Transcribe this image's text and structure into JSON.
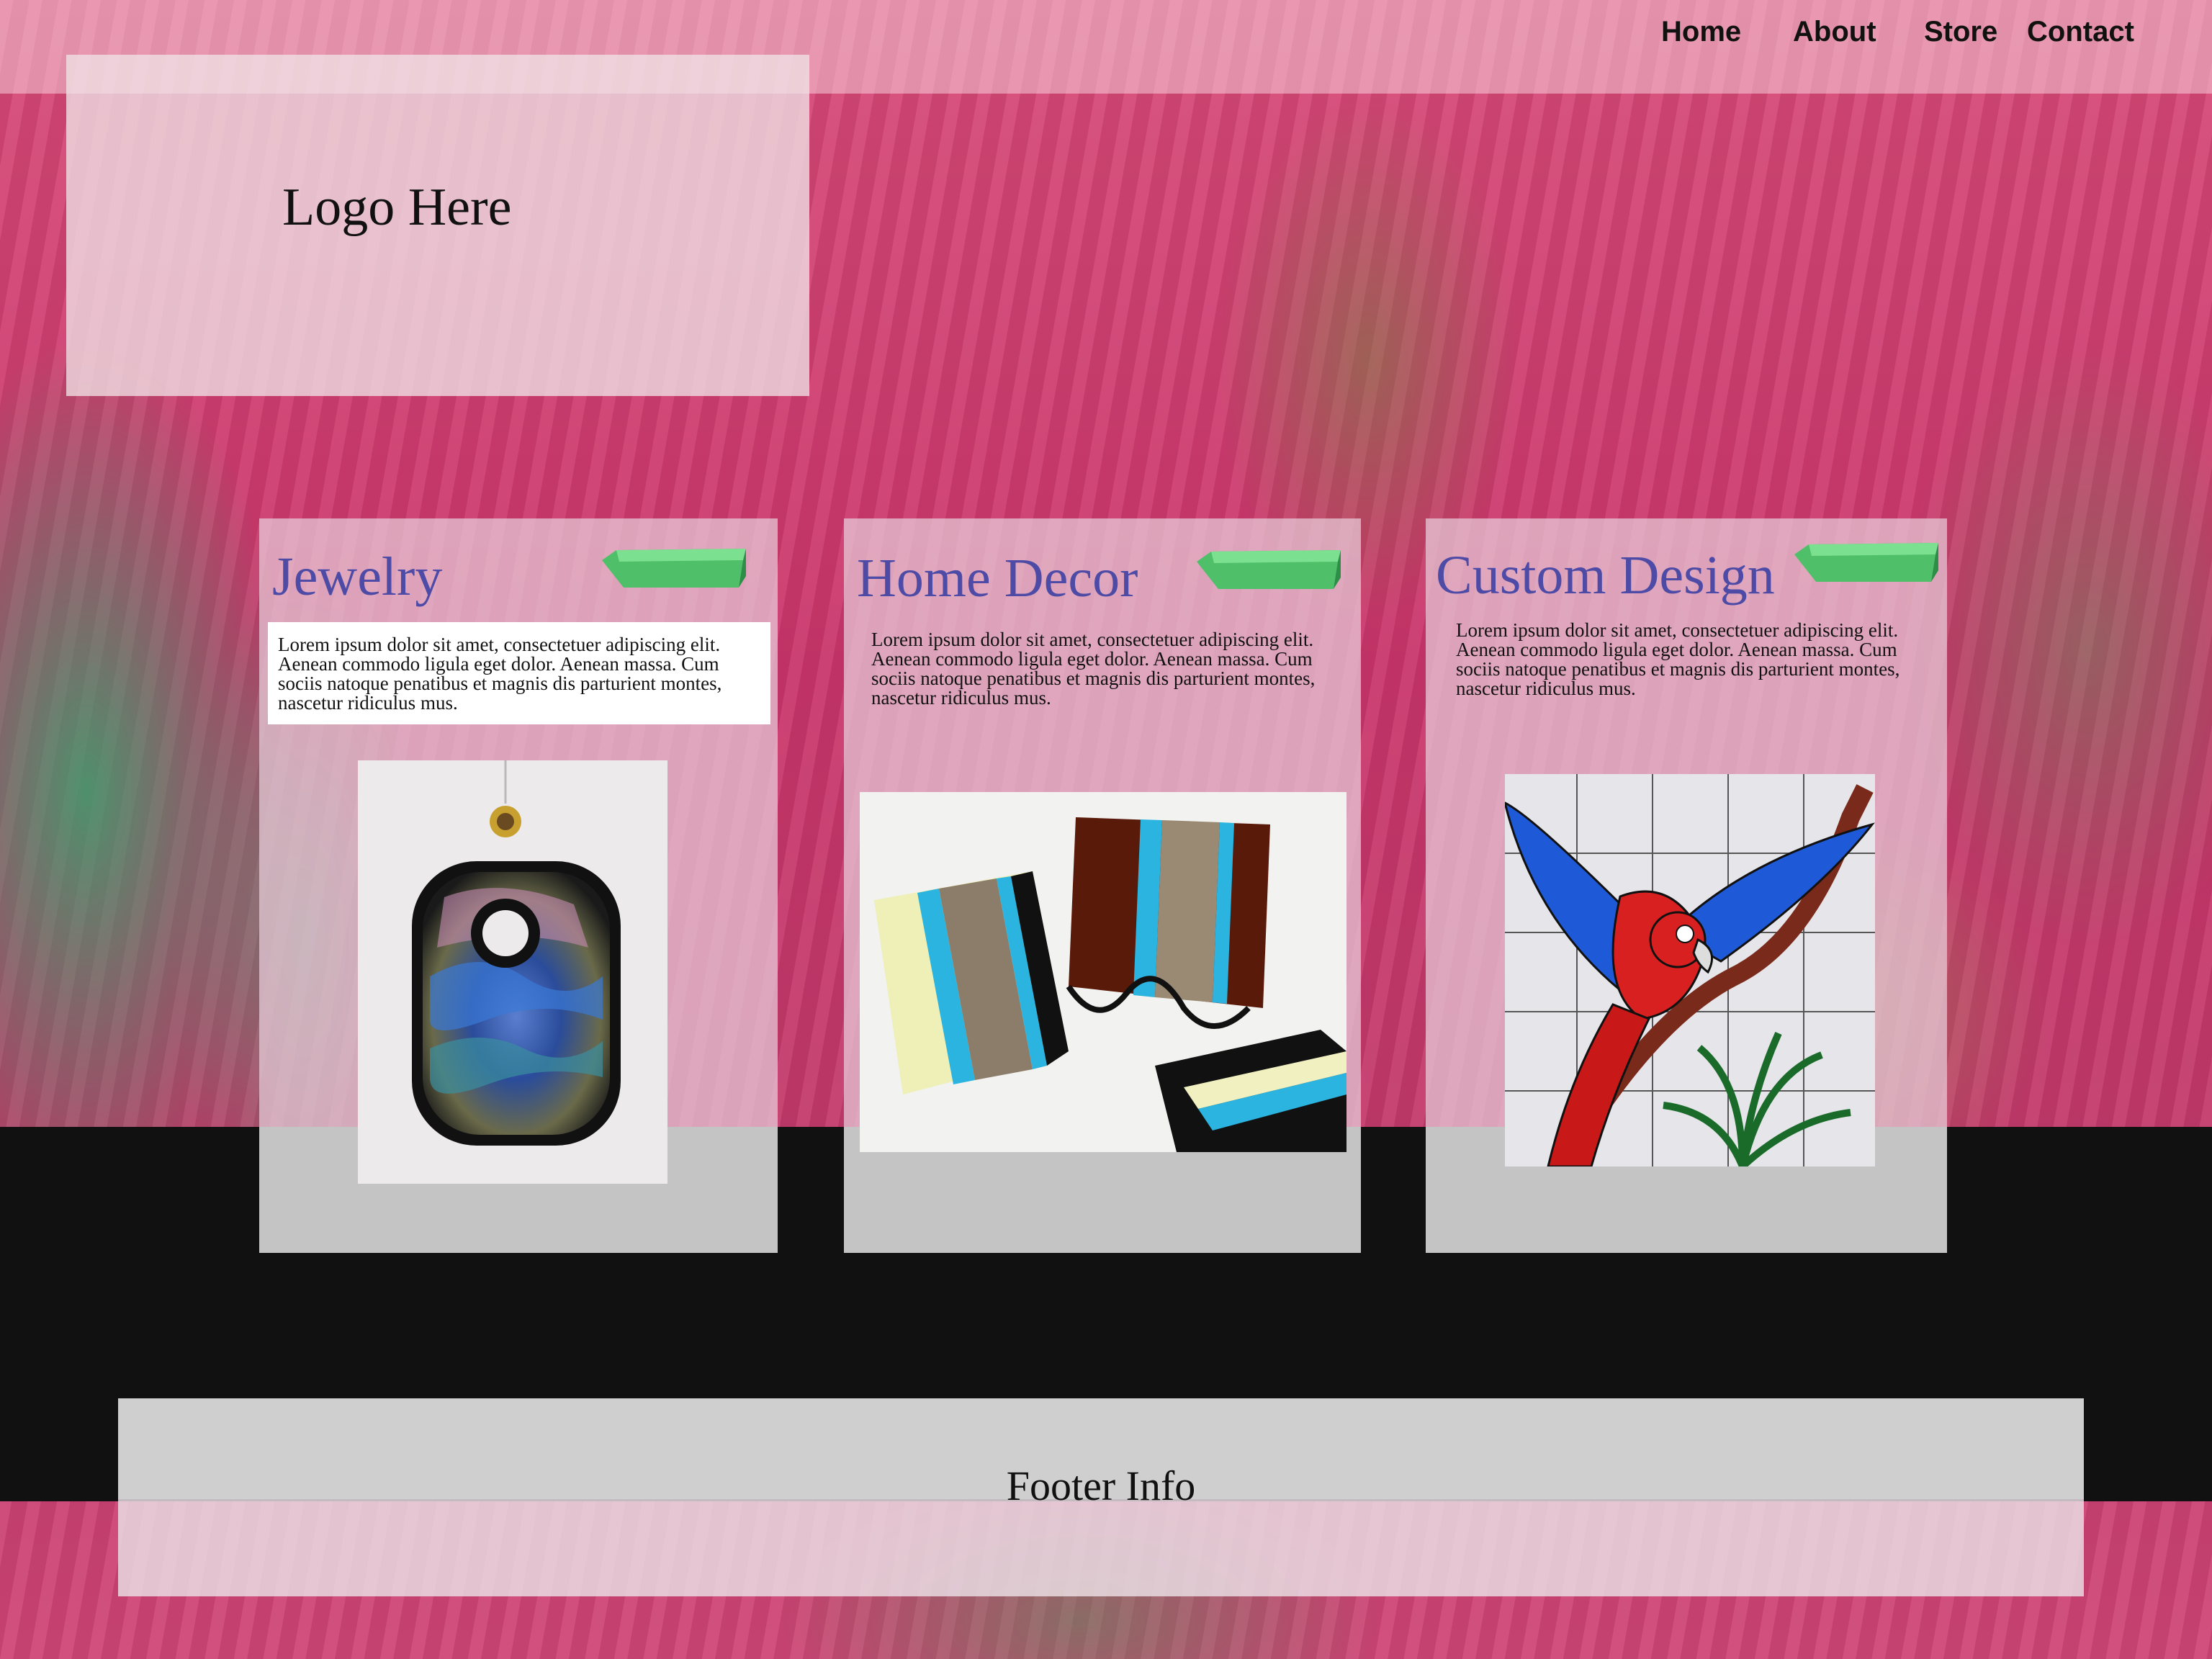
{
  "nav": {
    "items": [
      "Home",
      "About",
      "Store",
      "Contact"
    ]
  },
  "logo": {
    "text": "Logo Here"
  },
  "cards": [
    {
      "title": "Jewelry",
      "text": "Lorem ipsum dolor sit amet, consectetuer adipiscing elit. Aenean commodo ligula eget dolor. Aenean massa. Cum sociis natoque penatibus et magnis dis parturient montes, nascetur ridiculus mus.",
      "image": "glass-pendant"
    },
    {
      "title": "Home Decor",
      "text": "Lorem ipsum dolor sit amet, consectetuer adipiscing elit. Aenean commodo ligula eget dolor. Aenean massa. Cum sociis natoque penatibus et magnis dis parturient montes, nascetur ridiculus mus.",
      "image": "glass-plates"
    },
    {
      "title": "Custom Design",
      "text": "Lorem ipsum dolor sit amet, consectetuer adipiscing elit. Aenean commodo ligula eget dolor. Aenean massa. Cum sociis natoque penatibus et magnis dis parturient montes, nascetur ridiculus mus.",
      "image": "stained-glass-parrot"
    }
  ],
  "footer": {
    "text": "Footer Info"
  },
  "colors": {
    "title": "#4d4ba6",
    "ribbon": "#4fbf6a",
    "band": "#111111"
  }
}
